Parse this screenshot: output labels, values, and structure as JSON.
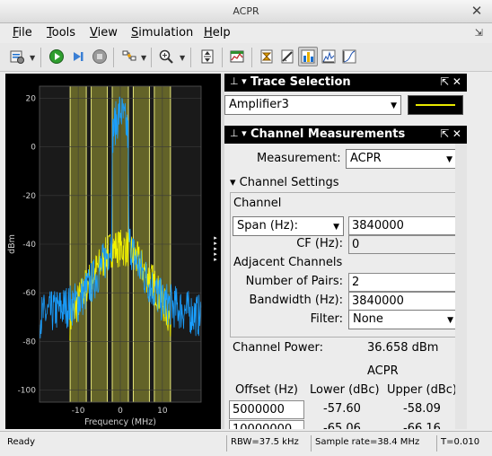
{
  "window": {
    "title": "ACPR"
  },
  "menu": {
    "items": [
      {
        "mnemonic": "F",
        "rest": "ile"
      },
      {
        "mnemonic": "T",
        "rest": "ools"
      },
      {
        "mnemonic": "V",
        "rest": "iew"
      },
      {
        "mnemonic": "S",
        "rest": "imulation"
      },
      {
        "mnemonic": "H",
        "rest": "elp"
      }
    ]
  },
  "toolbar": {
    "icons": [
      "settings-icon",
      "run-icon",
      "step-forward-icon",
      "stop-icon",
      "highlight-signal-icon",
      "zoom-in-icon",
      "autoscale-icon",
      "spectrum-settings-icon",
      "trace-selection-icon",
      "channel-measurements-icon",
      "cursor-measurements-icon",
      "peak-finder-icon",
      "distortion-icon",
      "ccdf-icon"
    ]
  },
  "plot": {
    "ylabel": "dBm",
    "xlabel": "Frequency (MHz)",
    "yticks": [
      "20",
      "0",
      "-20",
      "-40",
      "-60",
      "-80",
      "-100"
    ],
    "xticks": [
      "-10",
      "0",
      "10"
    ],
    "colors": {
      "background": "#000000",
      "frame": "#1a1a1a",
      "band": "#6b6b2a",
      "band_edge": "#e8e87a",
      "trace_main": "#1a9fff",
      "trace_adjacent": "#f2f200"
    }
  },
  "chart_data": {
    "type": "line",
    "title": "",
    "xlabel": "Frequency (MHz)",
    "ylabel": "dBm",
    "xlim": [
      -19.2,
      19.2
    ],
    "ylim": [
      -105,
      25
    ],
    "grid": true,
    "series": [
      {
        "x": [
          -19.2,
          -16,
          -13,
          -10,
          -8,
          -6,
          -4,
          -3,
          -2,
          -1.9,
          -1.5,
          -1,
          0,
          1,
          1.5,
          1.9,
          2,
          3,
          4,
          6,
          8,
          10,
          13,
          16,
          19.2
        ],
        "values": [
          -68,
          -66,
          -64,
          -62,
          -57,
          -52,
          -46,
          -42,
          -36,
          6,
          10,
          12,
          17,
          12,
          10,
          6,
          -36,
          -42,
          -46,
          -52,
          -57,
          -62,
          -64,
          -66,
          -68
        ]
      },
      {
        "x": [
          -12,
          -10,
          -8,
          -6,
          -4,
          -3,
          -2,
          2,
          3,
          4,
          6,
          8,
          10,
          12
        ],
        "values": [
          -70,
          -62,
          -55,
          -50,
          -45,
          -42,
          -40,
          -40,
          -42,
          -45,
          -50,
          -55,
          -62,
          -70
        ]
      }
    ],
    "bands_mhz": [
      [
        -11.92,
        -8.08
      ],
      [
        -6.92,
        -3.08
      ],
      [
        -1.92,
        1.92
      ],
      [
        3.08,
        6.92
      ],
      [
        8.08,
        11.92
      ]
    ]
  },
  "trace_selection": {
    "header": "Trace Selection",
    "selected": "Amplifier3",
    "line_color": "#e8e800"
  },
  "channel_measurements": {
    "header": "Channel Measurements",
    "measurement_label": "Measurement:",
    "measurement_value": "ACPR",
    "settings_label": "Channel Settings",
    "channel_group": "Channel",
    "span_select": "Span (Hz):",
    "span_value": "3840000",
    "cf_label": "CF (Hz):",
    "cf_value": "0",
    "adjacent_group": "Adjacent Channels",
    "pairs_label": "Number of Pairs:",
    "pairs_value": "2",
    "bandwidth_label": "Bandwidth (Hz):",
    "bandwidth_value": "3840000",
    "filter_label": "Filter:",
    "filter_value": "None",
    "channel_power_label": "Channel Power:",
    "channel_power_value": "36.658 dBm",
    "acpr_heading": "ACPR",
    "col_offset": "Offset (Hz)",
    "col_lower": "Lower (dBc)",
    "col_upper": "Upper (dBc)",
    "rows": [
      {
        "offset": "5000000",
        "lower": "-57.60",
        "upper": "-58.09"
      },
      {
        "offset": "10000000",
        "lower": "-65.06",
        "upper": "-66.16"
      }
    ]
  },
  "status": {
    "ready": "Ready",
    "rbw": "RBW=37.5 kHz",
    "sample_rate": "Sample rate=38.4 MHz",
    "time": "T=0.010"
  }
}
